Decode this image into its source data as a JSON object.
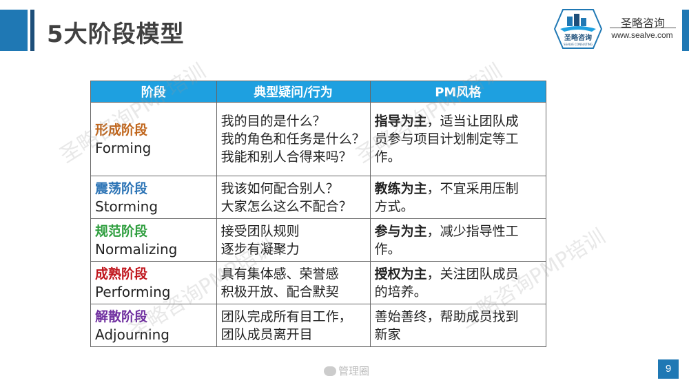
{
  "header": {
    "title": "5大阶段模型",
    "brand_name": "圣略咨询",
    "brand_site": "www.sealve.com",
    "logo_text": "圣略咨询",
    "logo_subtext": "SEALVE CONSULTING"
  },
  "table": {
    "headers": [
      "阶段",
      "典型疑问/行为",
      "PM风格"
    ],
    "rows": [
      {
        "stage_cn": "形成阶段",
        "stage_en": "Forming",
        "color": "#c0651b",
        "behaviors": [
          "我的目的是什么？",
          "我的角色和任务是什么？",
          "我能和别人合得来吗？"
        ],
        "style_bold": "指导为主",
        "style_rest": [
          "，适当让团队成",
          "员参与项目计划制定等工",
          "作。"
        ]
      },
      {
        "stage_cn": "震荡阶段",
        "stage_en": "Storming",
        "color": "#2e75b6",
        "behaviors": [
          "我该如何配合别人？",
          "大家怎么这么不配合？"
        ],
        "style_bold": "教练为主",
        "style_rest": [
          "，不宜采用压制",
          "方式。"
        ]
      },
      {
        "stage_cn": "规范阶段",
        "stage_en": "Normalizing",
        "color": "#2e9e3e",
        "behaviors": [
          "接受团队规则",
          "逐步有凝聚力"
        ],
        "style_bold": "参与为主",
        "style_rest": [
          "，减少指导性工",
          "作。"
        ]
      },
      {
        "stage_cn": "成熟阶段",
        "stage_en": "Performing",
        "color": "#c0161d",
        "behaviors": [
          "具有集体感、荣誉感",
          "积极开放、配合默契"
        ],
        "style_bold": "授权为主",
        "style_rest": [
          "，关注团队成员",
          "的培养。"
        ]
      },
      {
        "stage_cn": "解散阶段",
        "stage_en": "Adjourning",
        "color": "#7030a0",
        "behaviors": [
          "团队完成所有目工作，",
          "团队成员离开目"
        ],
        "style_bold": "",
        "style_rest": [
          "善始善终，帮助成员找到",
          "新家"
        ]
      }
    ]
  },
  "watermarks": [
    "圣略咨询PMP培训",
    "圣略咨询PMP培训",
    "圣略咨询PMP培训",
    "圣略咨询PMP培训"
  ],
  "footer": {
    "source": "管理圈",
    "page_number": "9"
  },
  "colors": {
    "accent": "#1f78b4",
    "header_fill": "#1ea0e0"
  }
}
